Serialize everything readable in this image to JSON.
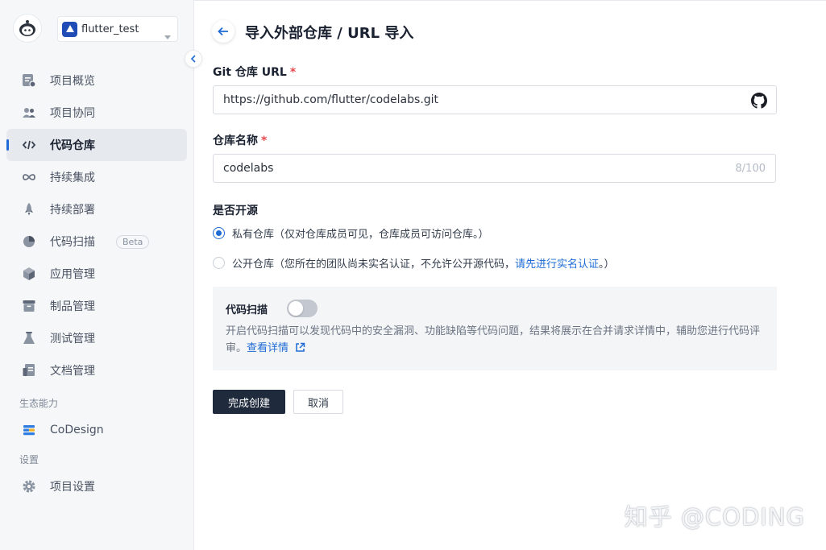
{
  "project": {
    "name": "flutter_test"
  },
  "sidebar": {
    "items": [
      {
        "label": "项目概览",
        "icon": "overview-icon"
      },
      {
        "label": "项目协同",
        "icon": "team-icon"
      },
      {
        "label": "代码仓库",
        "icon": "code-icon",
        "active": true
      },
      {
        "label": "持续集成",
        "icon": "infinity-icon"
      },
      {
        "label": "持续部署",
        "icon": "rocket-icon"
      },
      {
        "label": "代码扫描",
        "icon": "pie-icon",
        "badge": "Beta"
      },
      {
        "label": "应用管理",
        "icon": "cube-icon"
      },
      {
        "label": "制品管理",
        "icon": "archive-icon"
      },
      {
        "label": "测试管理",
        "icon": "flask-icon"
      },
      {
        "label": "文档管理",
        "icon": "doc-icon"
      }
    ],
    "section_eco": "生态能力",
    "codesign": "CoDesign",
    "section_settings": "设置",
    "settings_item": "项目设置"
  },
  "page": {
    "title": "导入外部仓库 / URL 导入"
  },
  "form": {
    "git_url_label": "Git 仓库 URL",
    "required_mark": "*",
    "git_url_value": "https://github.com/flutter/codelabs.git",
    "repo_name_label": "仓库名称",
    "repo_name_value": "codelabs",
    "repo_name_counter": "8/100",
    "open_source_label": "是否开源",
    "private_option": "私有仓库（仅对仓库成员可见，仓库成员可访问仓库。）",
    "public_option_prefix": "公开仓库（您所在的团队尚未实名认证，不允许公开源代码，",
    "public_option_link": "请先进行实名认证",
    "public_option_suffix": "。）",
    "scan_title": "代码扫描",
    "scan_enabled": false,
    "scan_desc": "开启代码扫描可以发现代码中的安全漏洞、功能缺陷等代码问题，结果将展示在合并请求详情中，辅助您进行代码评审。",
    "scan_link": "查看详情",
    "submit": "完成创建",
    "cancel": "取消"
  },
  "watermark": "知乎 @CODING",
  "colors": {
    "accent": "#1e6bd6",
    "primary_button": "#1f2a3d",
    "required": "#e5484d"
  }
}
